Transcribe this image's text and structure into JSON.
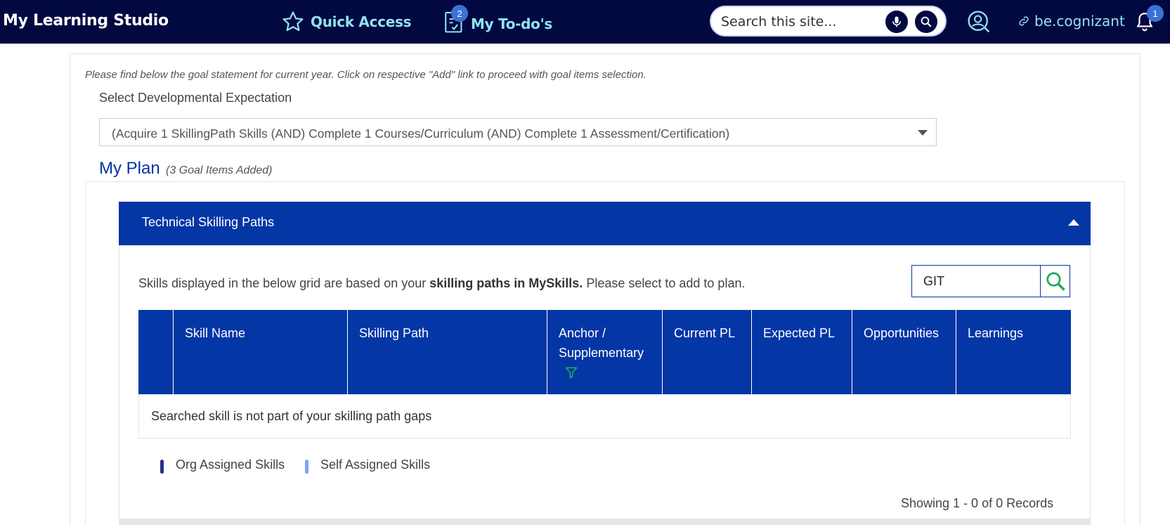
{
  "header": {
    "brand": "My Learning Studio",
    "quick_access": "Quick Access",
    "todos": "My To-do's",
    "todos_badge": "2",
    "search_placeholder": "Search this site...",
    "link_label": "be.cognizant",
    "notif_badge": "1",
    "bg_color": "#020840",
    "accent_color": "#8fe3ee"
  },
  "page": {
    "note": "Please find below the goal statement for current year. Click on respective \"Add\" link to proceed with goal items selection.",
    "dev_label": "Select Developmental Expectation",
    "dev_selected": "(Acquire 1 SkillingPath Skills (AND) Complete 1 Courses/Curriculum (AND) Complete 1 Assessment/Certification)",
    "myplan_title": "My Plan",
    "myplan_sub": "(3 Goal Items Added)"
  },
  "section": {
    "title": "Technical Skilling Paths",
    "desc_pre": "Skills displayed in the below grid are based on your ",
    "desc_bold": "skilling paths in MySkills.",
    "desc_post": " Please select to add to plan.",
    "search_value": "GIT",
    "columns": [
      "Skill Name",
      "Skilling Path",
      "Anchor / Supplementary",
      "Current PL",
      "Expected PL",
      "Opportunities",
      "Learnings"
    ],
    "empty_message": "Searched skill is not part of your skilling path gaps",
    "legend_org": "Org Assigned Skills",
    "legend_self": "Self Assigned Skills",
    "showing": "Showing 1 - 0 of 0 Records",
    "primary_color": "#0436a6"
  }
}
